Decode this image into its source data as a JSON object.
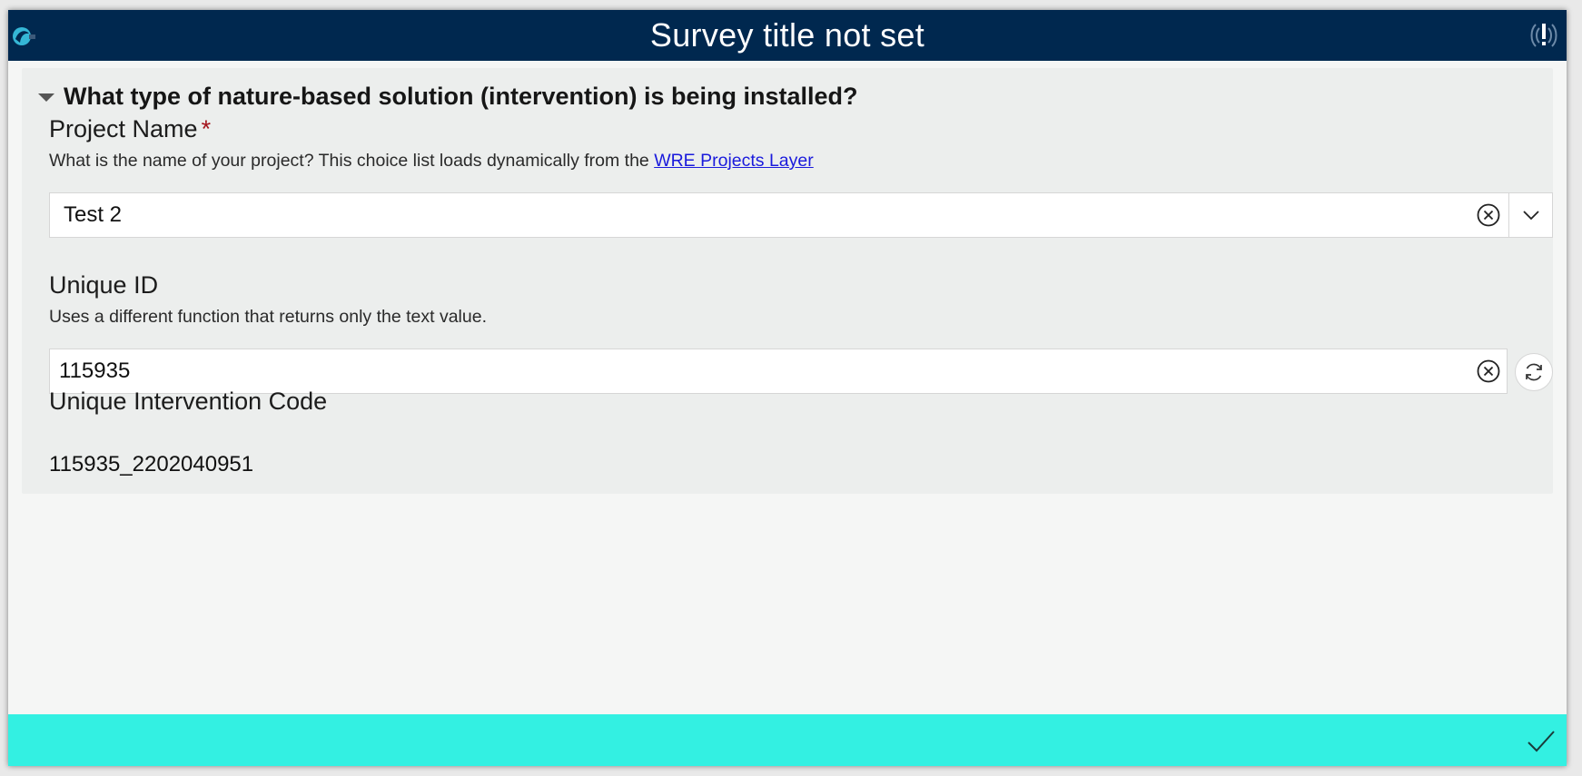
{
  "window": {
    "title": "Survey title not set"
  },
  "icons": {
    "app_logo": "survey123-logo-icon",
    "top_right": "gps-warning-icon",
    "collapse": "caret-down-icon",
    "clear": "clear-circle-icon",
    "dropdown": "chevron-down-icon",
    "refresh": "refresh-icon",
    "submit": "checkmark-icon"
  },
  "group": {
    "title": "What type of nature-based solution (intervention) is being installed?"
  },
  "project_name": {
    "label": "Project Name",
    "required_mark": "*",
    "hint_text": "What is the name of your project? This choice list loads dynamically from the ",
    "hint_link": "WRE Projects Layer",
    "value": "Test 2"
  },
  "unique_id": {
    "label": "Unique ID",
    "hint_text": "Uses a different function that returns only the text value.",
    "value": "115935"
  },
  "intervention_code": {
    "label": "Unique Intervention Code",
    "value": "115935_2202040951"
  },
  "colors": {
    "title_bar": "#00284f",
    "footer": "#33f0e2",
    "required": "#a3121b",
    "link": "#1a1adc"
  }
}
